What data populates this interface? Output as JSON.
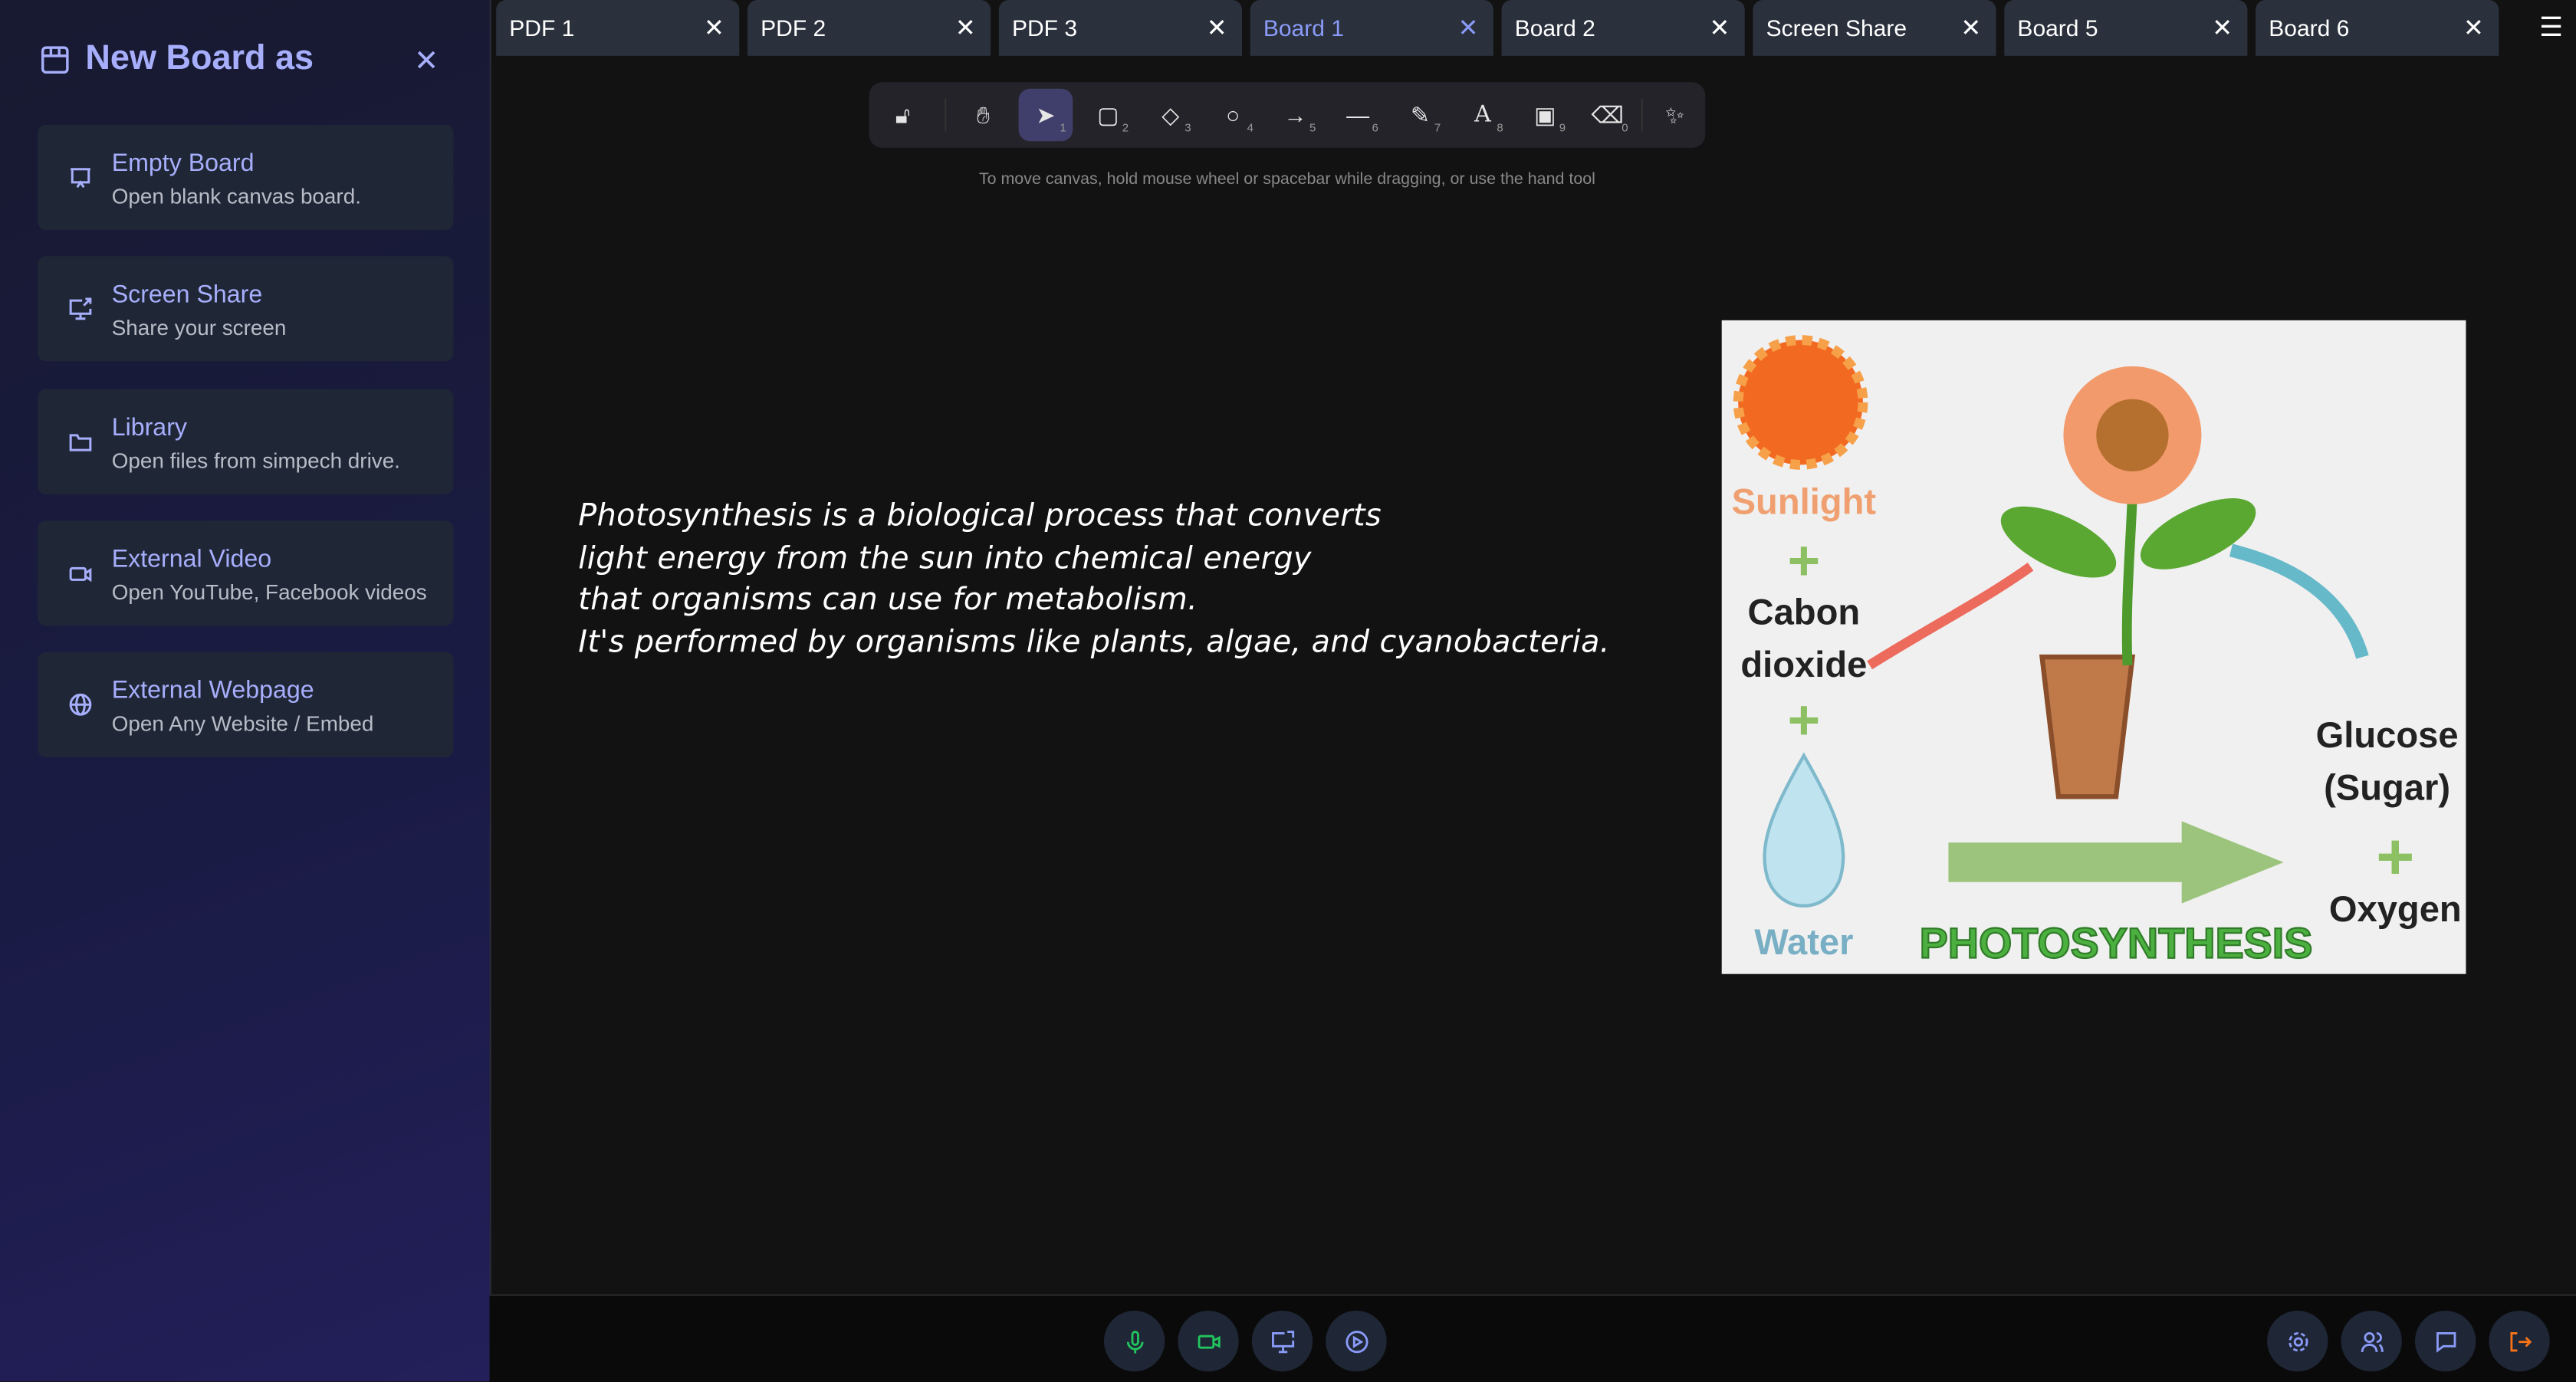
{
  "sidebar": {
    "title": "New Board as",
    "items": [
      {
        "label": "Empty Board",
        "desc": "Open blank canvas board.",
        "icon": "presentation-icon"
      },
      {
        "label": "Screen Share",
        "desc": "Share your screen",
        "icon": "screen-share-icon"
      },
      {
        "label": "Library",
        "desc": "Open files from simpech drive.",
        "icon": "folder-icon"
      },
      {
        "label": "External Video",
        "desc": "Open YouTube, Facebook videos",
        "icon": "video-icon"
      },
      {
        "label": "External Webpage",
        "desc": "Open Any Website / Embed",
        "icon": "globe-icon"
      }
    ]
  },
  "tabs": [
    {
      "label": "PDF 1"
    },
    {
      "label": "PDF 2"
    },
    {
      "label": "PDF 3"
    },
    {
      "label": "Board 1",
      "active": true
    },
    {
      "label": "Board 2"
    },
    {
      "label": "Screen Share"
    },
    {
      "label": "Board 5"
    },
    {
      "label": "Board 6"
    }
  ],
  "toolbar": {
    "shortcuts": [
      "1",
      "2",
      "3",
      "4",
      "5",
      "6",
      "7",
      "8",
      "9",
      "0"
    ],
    "selected": "selection"
  },
  "hint": "To move canvas, hold mouse wheel or spacebar while dragging, or use the hand tool",
  "note": "Photosynthesis is a biological process that converts\nlight energy from the sun into chemical energy\nthat organisms can use for metabolism.\nIt's performed by organisms like plants, algae, and cyanobacteria.",
  "image": {
    "sunlight": "Sunlight",
    "co2_1": "Cabon",
    "co2_2": "dioxide",
    "water": "Water",
    "glucose_1": "Glucose",
    "glucose_2": "(Sugar)",
    "oxygen": "Oxygen",
    "title": "PHOTOSYNTHESIS"
  },
  "colors": {
    "accent": "#a7aefc",
    "active_tab": "#8a9bf8",
    "mic": "#22c55e",
    "leave": "#f97316"
  }
}
